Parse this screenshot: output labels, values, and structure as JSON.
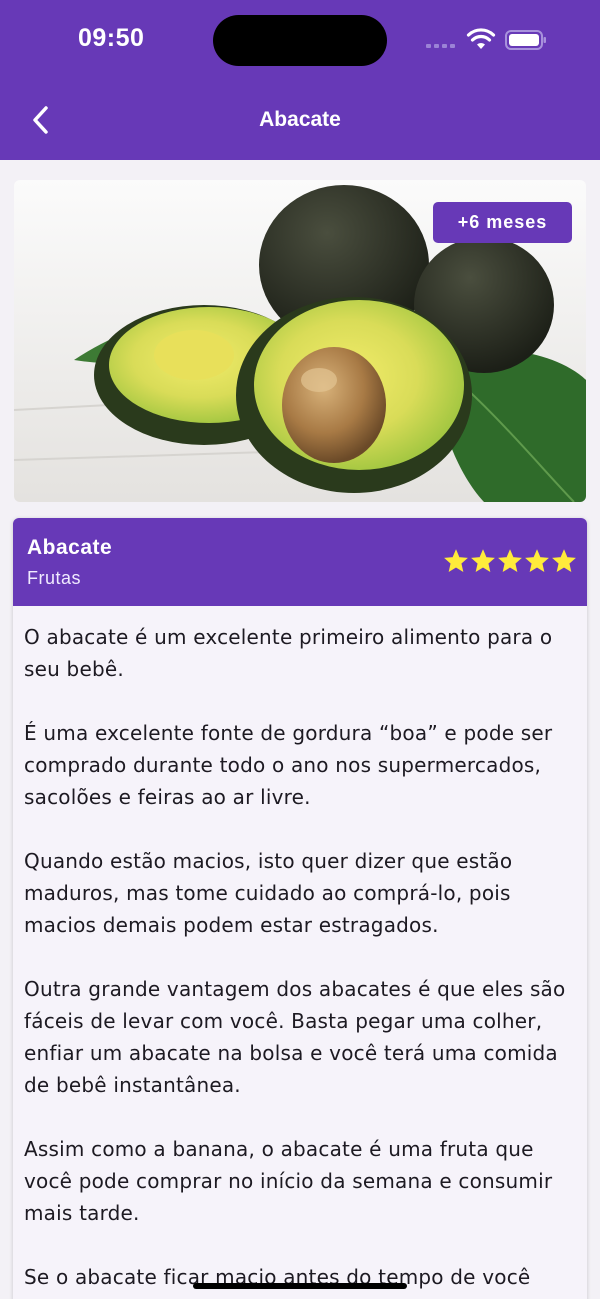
{
  "status_bar": {
    "time": "09:50"
  },
  "nav": {
    "title": "Abacate"
  },
  "hero": {
    "age_badge": "+6 meses"
  },
  "card": {
    "title": "Abacate",
    "category": "Frutas",
    "rating": 5,
    "paragraphs": [
      "O abacate é um excelente primeiro alimento para o seu bebê.",
      "É uma excelente fonte de gordura “boa” e pode ser comprado durante todo o ano nos supermercados, sacolões e feiras ao ar livre.",
      "Quando estão macios, isto quer dizer que estão maduros, mas tome cuidado ao comprá-lo, pois macios demais podem estar estragados.",
      "Outra grande vantagem dos abacates é que eles são fáceis de levar com você. Basta pegar uma colher, enfiar um abacate na bolsa e você terá uma comida de bebê instantânea.",
      "Assim como a banana, o abacate é uma fruta que você pode comprar no início da semana e consumir mais tarde.",
      "Se o abacate ficar macio antes do tempo de você"
    ]
  },
  "colors": {
    "accent": "#6739b7",
    "star": "#ffeb3b"
  },
  "icons": [
    "back-chevron-icon",
    "wifi-icon",
    "battery-icon",
    "star-icon"
  ]
}
